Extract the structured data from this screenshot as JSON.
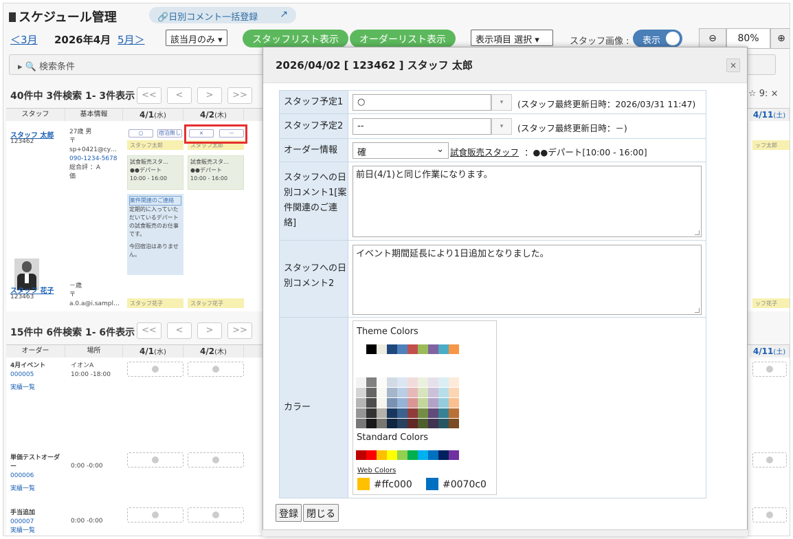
{
  "app": {
    "title": "スケジュール管理",
    "bulk_comment": "日別コメント一括登録"
  },
  "nav": {
    "prev": "＜3月",
    "current": "2026年4月",
    "next": "5月＞",
    "filter": "該当月のみ",
    "staff_list": "スタッフリスト表示",
    "order_list": "オーダーリスト表示",
    "display_items": "表示項目 選択",
    "staff_image": "スタッフ画像 :",
    "toggle": "表示",
    "zoom": "80%"
  },
  "search": {
    "label": "検索条件"
  },
  "staff_grid": {
    "count": "40件中 3件検索 1- 3件表示",
    "pager": [
      "<<",
      "<",
      ">",
      ">>"
    ],
    "headers": [
      "スタッフ",
      "基本情報",
      "4/1",
      "(水)",
      "4/2",
      "(木)",
      "4/11",
      "(土)"
    ],
    "right_meta": "☆ 9: ×",
    "staff1": {
      "name": "スタッフ 太郎",
      "id": "123462",
      "age": "27歳 男",
      "t1": "〒",
      "email": "sp+0421@cy…",
      "tel": "090-1234-5678",
      "score": "総合評 ：A",
      "score2": "価",
      "plus": "+",
      "c1a": "○",
      "c1b": "宿泊無し",
      "c2a": "×",
      "c2b": "－",
      "yellow1": "スタッフ太郎",
      "yellow2": "スタッフ太郎",
      "g1t": "試食販売スタ…",
      "g1b": "●●デパート",
      "g1c": "10:00 - 16:00",
      "g2t": "試食販売スタ…",
      "g2b": "●●デパート",
      "g2c": "10:00 - 16:00",
      "b1": "案件関連のご連絡",
      "b2": "定期的に入っていただいているデパートの試食販売のお仕事です。",
      "b3": "今回宿泊はありません。",
      "right_y": "ッフ太郎"
    },
    "staff2": {
      "name": "スタッフ 花子",
      "id": "123463",
      "age": "－歳",
      "t1": "〒",
      "email": "a.0.a@i.sampl…",
      "y1": "スタッフ花子",
      "y2": "スタッフ花子",
      "right_y": "ッフ花子"
    }
  },
  "order_grid": {
    "count": "15件中 6件検索 1- 6件表示",
    "headers": [
      "オーダー",
      "場所",
      "4/1",
      "(水)",
      "4/2",
      "(木)",
      "4/11",
      "(土)"
    ],
    "rows": [
      {
        "name": "4月イベント",
        "id": "000005",
        "link": "実績一覧",
        "place": "イオンA",
        "time": "10:00 -18:00"
      },
      {
        "name": "単価テストオーダー",
        "id": "000006",
        "link": "実績一覧",
        "place": "",
        "time": "0:00 -0:00"
      },
      {
        "name": "手当追加",
        "id": "000007",
        "link": "実績一覧",
        "place": "",
        "time": "0:00 -0:00"
      }
    ]
  },
  "modal": {
    "title": "2026/04/02 [ 123462 ] スタッフ 太郎",
    "close": "×",
    "rows": {
      "plan1": "スタッフ予定1",
      "plan1_value": "○",
      "plan1_note": "(スタッフ最終更新日時：2026/03/31 11:47)",
      "plan2": "スタッフ予定2",
      "plan2_value": "--",
      "plan2_note": "(スタッフ最終更新日時：－)",
      "order": "オーダー情報",
      "order_value": "確",
      "order_link": "試食販売スタッフ",
      "order_text": "：●●デパート[10:00 - 16:00]",
      "comment1": "スタッフへの日別コメント1[案件関連のご連絡]",
      "comment1_value": "前日(4/1)と同じ作業になります。",
      "comment2": "スタッフへの日別コメント2",
      "comment2_value": "イベント期間延長により1日追加となりました。",
      "color": "カラー"
    },
    "picker": {
      "theme": "Theme Colors",
      "standard": "Standard Colors",
      "web": "Web Colors",
      "c1": "#ffc000",
      "c2": "#0070c0"
    },
    "register": "登録",
    "close_btn": "閉じる"
  },
  "colors": {
    "theme": [
      "#ffffff",
      "#000000",
      "#eeece1",
      "#1f497d",
      "#4f81bd",
      "#c0504d",
      "#9bbb59",
      "#8064a2",
      "#4bacc6",
      "#f79646"
    ],
    "standard": [
      "#c00000",
      "#ff0000",
      "#ffc000",
      "#ffff00",
      "#92d050",
      "#00b050",
      "#00b0f0",
      "#0070c0",
      "#002060",
      "#7030a0"
    ]
  }
}
